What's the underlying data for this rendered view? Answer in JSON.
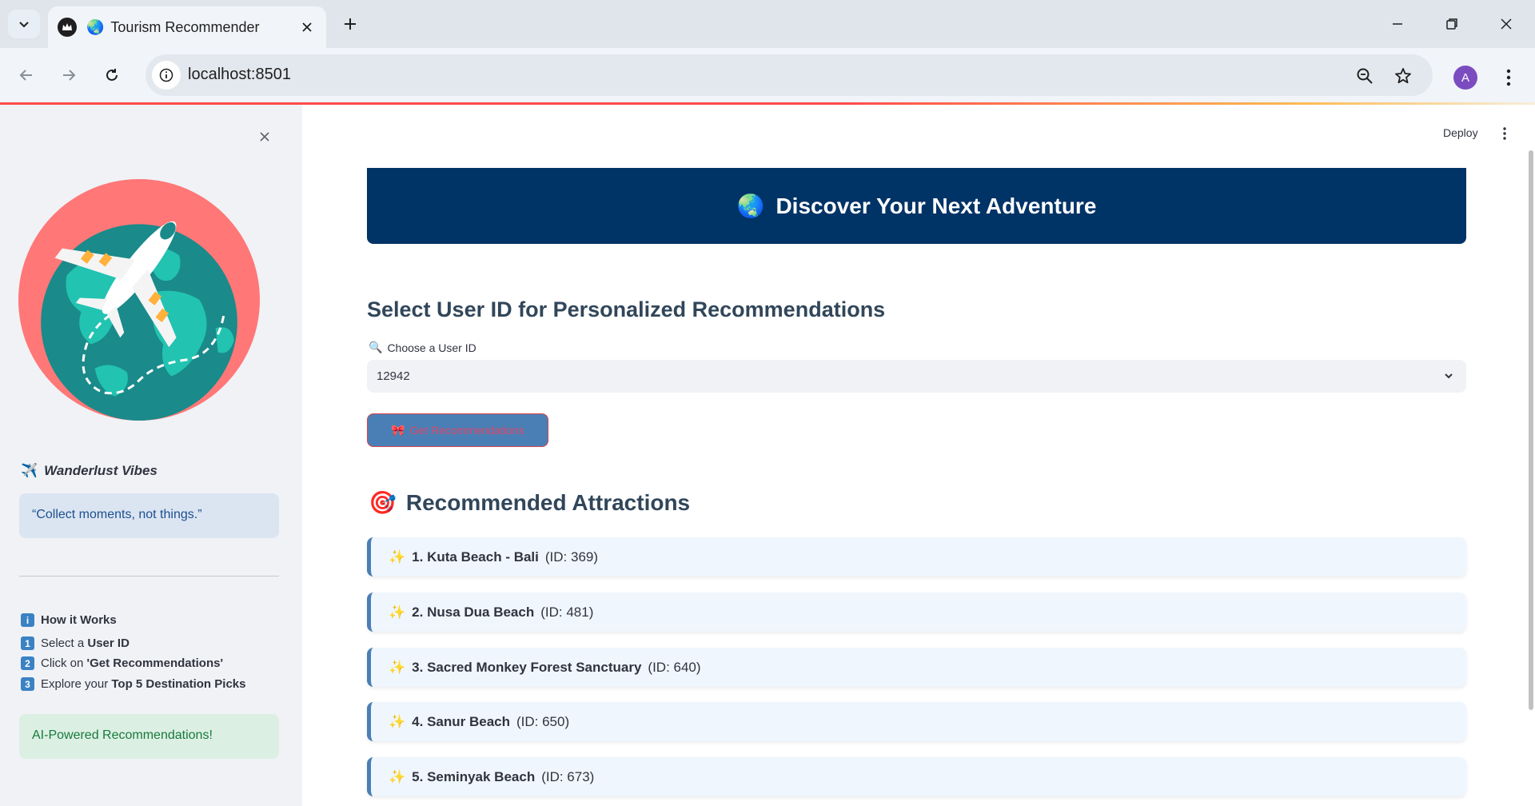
{
  "browser": {
    "tab_title": "Tourism Recommender",
    "url": "localhost:8501",
    "avatar_letter": "A"
  },
  "app": {
    "deploy_label": "Deploy",
    "banner_title": "Discover Your Next Adventure",
    "select_heading": "Select User ID for Personalized Recommendations",
    "select_label": "Choose a User ID",
    "selected_user": "12942",
    "button_label": "Get Recommendations",
    "rec_heading": "Recommended Attractions",
    "recommendations": [
      {
        "name": "1. Kuta Beach - Bali",
        "id": "(ID: 369)"
      },
      {
        "name": "2. Nusa Dua Beach",
        "id": "(ID: 481)"
      },
      {
        "name": "3. Sacred Monkey Forest Sanctuary",
        "id": "(ID: 640)"
      },
      {
        "name": "4. Sanur Beach",
        "id": "(ID: 650)"
      },
      {
        "name": "5. Seminyak Beach",
        "id": "(ID: 673)"
      }
    ]
  },
  "sidebar": {
    "wander_title": "Wanderlust Vibes",
    "quote": "“Collect moments, not things.”",
    "how_title": "How it Works",
    "steps": [
      {
        "pre": "Select a ",
        "bold": "User ID",
        "num": "1"
      },
      {
        "pre": "Click on ",
        "bold": "'Get Recommendations'",
        "num": "2"
      },
      {
        "pre": "Explore your ",
        "bold": "Top 5 Destination Picks",
        "num": "3"
      }
    ],
    "ai_note": "AI-Powered Recommendations!"
  },
  "colors": {
    "banner": "#003366",
    "card_accent": "#4a7fb5",
    "sidebar_bg": "#f0f2f6"
  }
}
